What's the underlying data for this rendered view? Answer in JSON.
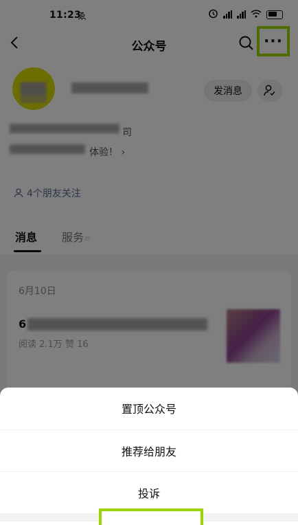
{
  "status_bar": {
    "time": "11:23",
    "aux_symbol": "ゑ",
    "signal_labels": [
      "HD",
      "HD"
    ],
    "battery": "battery-icon"
  },
  "nav": {
    "title": "公众号",
    "back_icon": "chevron-left-icon",
    "search_icon": "search-icon",
    "more_label": "···",
    "highlight_color": "#9cd600"
  },
  "profile": {
    "message_button": "发消息",
    "company_suffix": "司",
    "intro_text": "体验！",
    "intro_arrow": "›",
    "friends_follow": "4个朋友关注"
  },
  "tabs": [
    {
      "label": "消息"
    },
    {
      "label": "服务",
      "suffix": "≡"
    }
  ],
  "article": {
    "date": "6月10日",
    "title_prefix": "6",
    "stats": "阅读 2.1万  赞 16"
  },
  "action_sheet": {
    "items": [
      "置顶公众号",
      "推荐给朋友",
      "投诉"
    ]
  }
}
